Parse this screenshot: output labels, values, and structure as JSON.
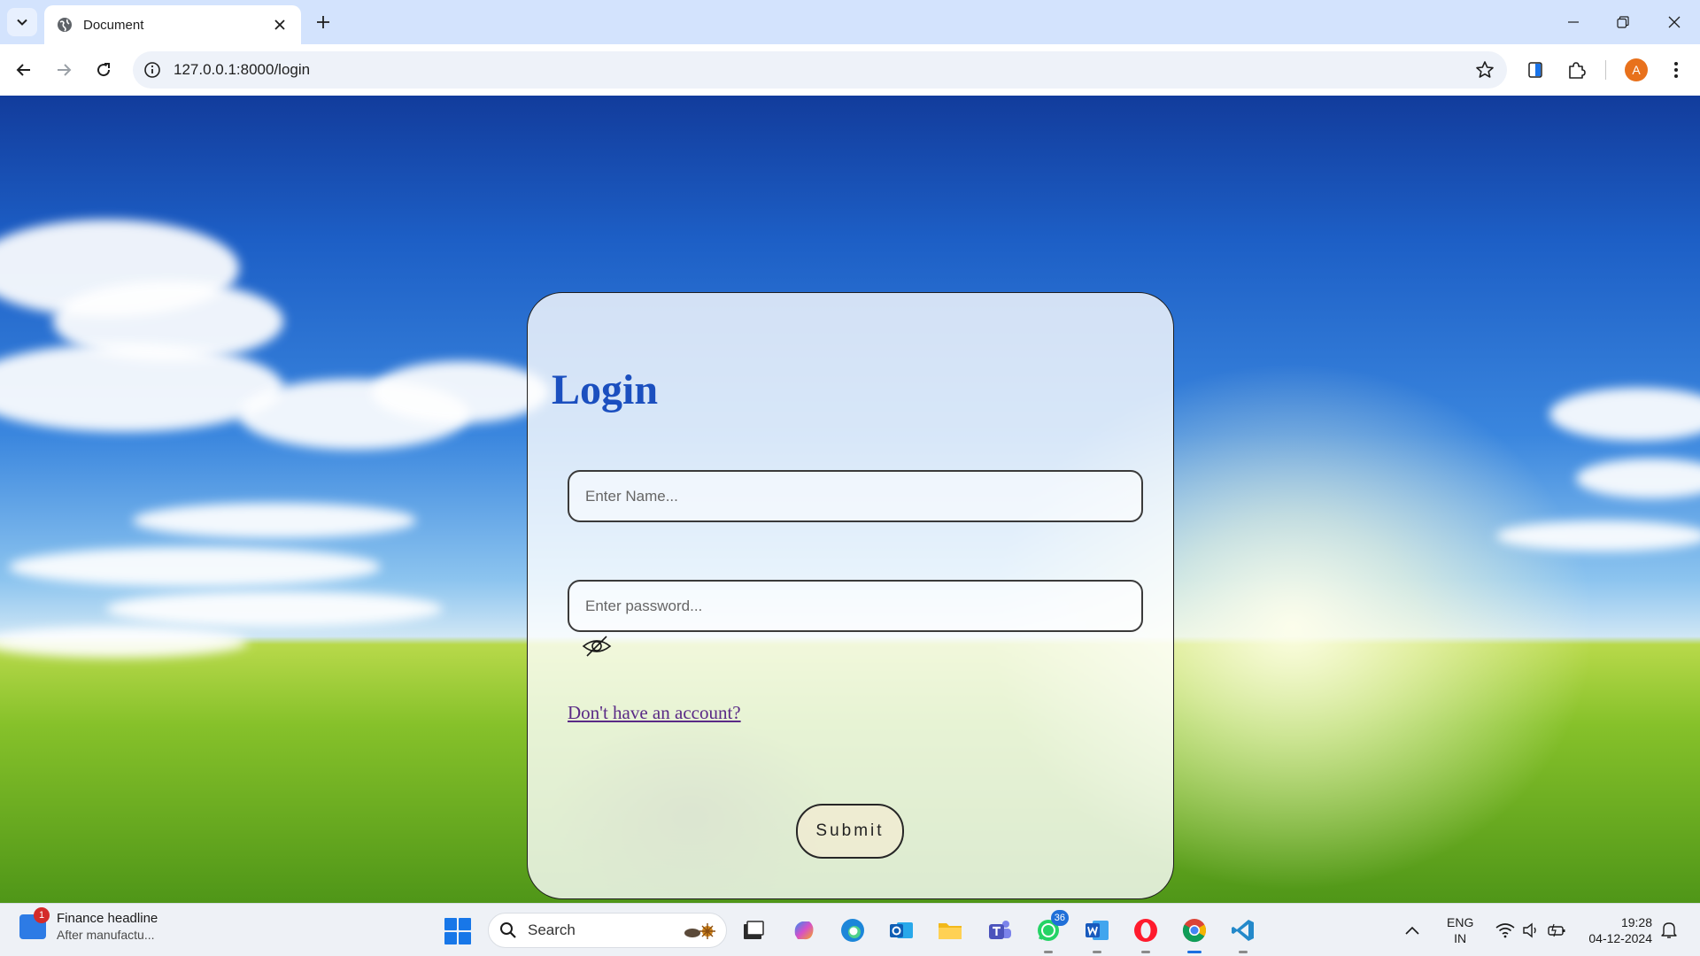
{
  "browser": {
    "tab_title": "Document",
    "url": "127.0.0.1:8000/login",
    "profile_initial": "A"
  },
  "login": {
    "title": "Login",
    "name_placeholder": "Enter Name...",
    "password_placeholder": "Enter password...",
    "signup_link": "Don't have an account?",
    "submit_label": "Submit"
  },
  "taskbar": {
    "news_title": "Finance headline",
    "news_subtitle": "After manufactu...",
    "news_badge": "1",
    "search_label": "Search",
    "whatsapp_badge": "36",
    "lang_line1": "ENG",
    "lang_line2": "IN",
    "time": "19:28",
    "date": "04-12-2024"
  },
  "colors": {
    "title_blue": "#1b4fbf",
    "link_purple": "#5a2a86",
    "avatar_orange": "#e8711c"
  }
}
